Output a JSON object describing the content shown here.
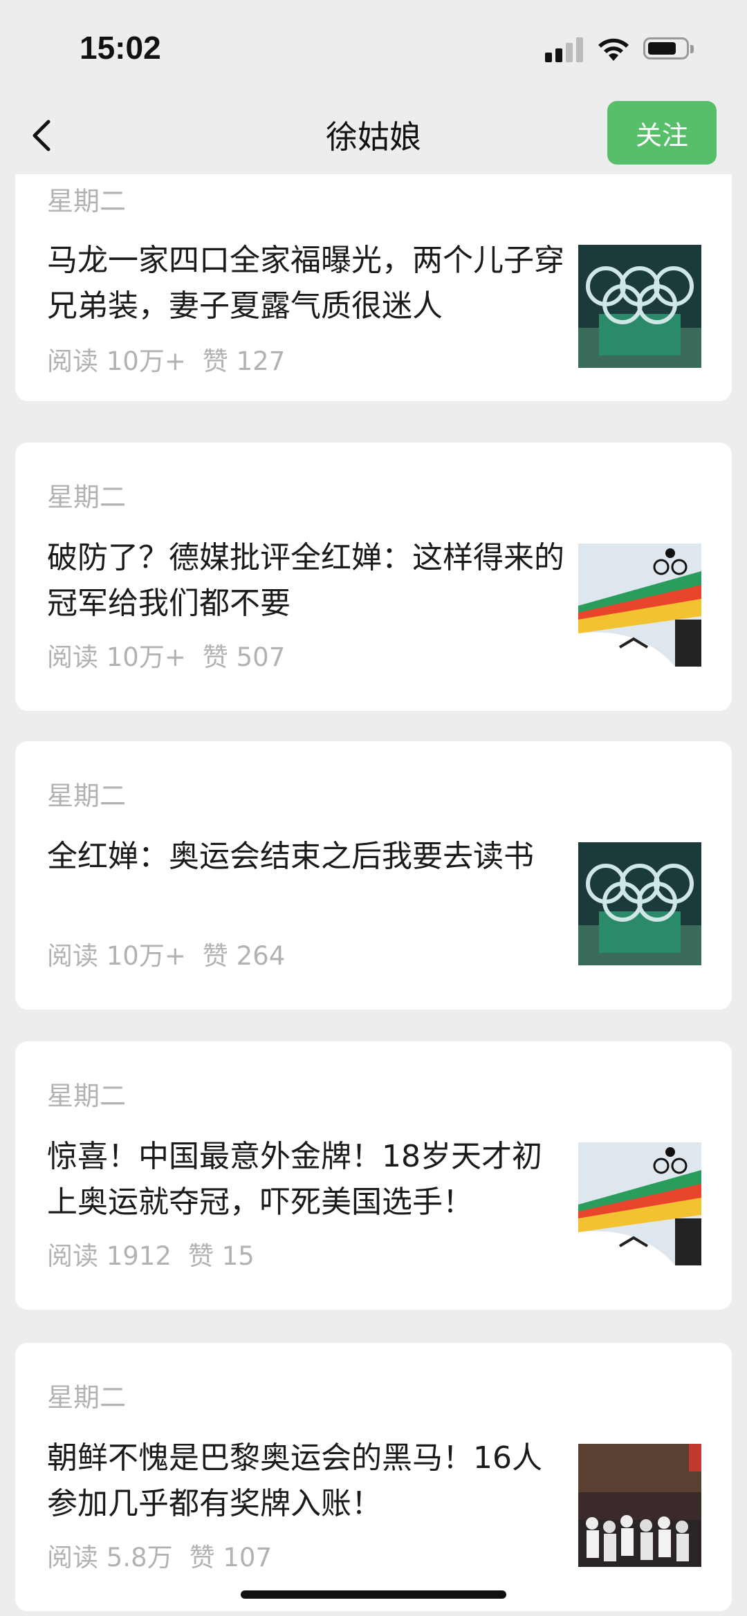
{
  "status_bar": {
    "time": "15:02"
  },
  "nav": {
    "title": "徐姑娘",
    "follow_label": "关注"
  },
  "articles": [
    {
      "day": "星期二",
      "title": "马龙一家四口全家福曝光，两个儿子穿兄弟装，妻子夏露气质很迷人",
      "reads": "阅读 10万+",
      "likes": "赞 127",
      "thumb_icon": "olympic-rings-image"
    },
    {
      "day": "星期二",
      "title": "破防了？德媒批评全红婵：这样得来的冠军给我们都不要",
      "reads": "阅读 10万+",
      "likes": "赞 507",
      "thumb_icon": "bmx-ramp-image"
    },
    {
      "day": "星期二",
      "title": "全红婵：奥运会结束之后我要去读书",
      "reads": "阅读 10万+",
      "likes": "赞 264",
      "thumb_icon": "olympic-rings-image"
    },
    {
      "day": "星期二",
      "title": "惊喜！中国最意外金牌！18岁天才初上奥运就夺冠，吓死美国选手！",
      "reads": "阅读 1912",
      "likes": "赞 15",
      "thumb_icon": "bmx-ramp-image"
    },
    {
      "day": "星期二",
      "title": "朝鲜不愧是巴黎奥运会的黑马！16人参加几乎都有奖牌入账！",
      "reads": "阅读 5.8万",
      "likes": "赞 107",
      "thumb_icon": "ceremony-crowd-image"
    }
  ],
  "colors": {
    "background": "#ededed",
    "follow_button": "#57be6a",
    "meta_text": "#b2b2b2",
    "title_text": "#1a1a1a"
  }
}
